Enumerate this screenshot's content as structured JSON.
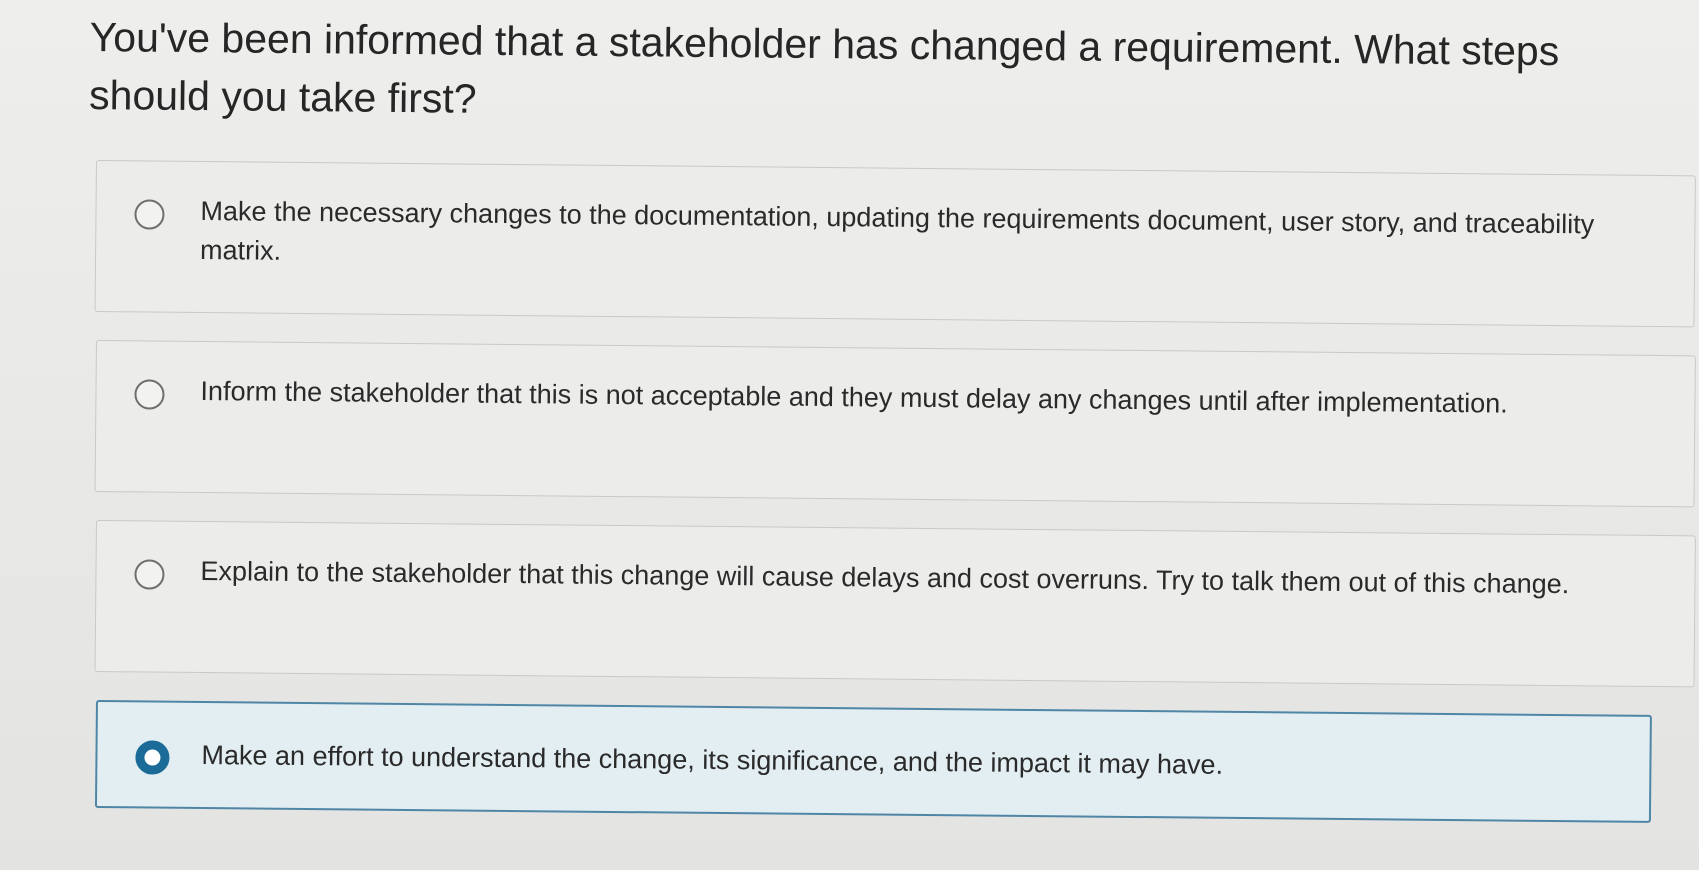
{
  "question": {
    "text": "You've been informed that a stakeholder has changed a requirement. What steps should you take first?"
  },
  "options": [
    {
      "label": "Make the necessary changes to the documentation, updating the requirements document, user story, and traceability matrix.",
      "selected": false
    },
    {
      "label": "Inform the stakeholder that this is not acceptable and they must delay any changes until after implementation.",
      "selected": false
    },
    {
      "label": "Explain to the stakeholder that this change will cause delays and cost overruns. Try to talk them out of this change.",
      "selected": false
    },
    {
      "label": "Make an effort to understand the change, its significance, and the impact it may have.",
      "selected": true
    }
  ],
  "colors": {
    "selected_accent": "#1a6b97",
    "selected_border": "#4f86a6",
    "selected_background": "#e3eef2"
  }
}
